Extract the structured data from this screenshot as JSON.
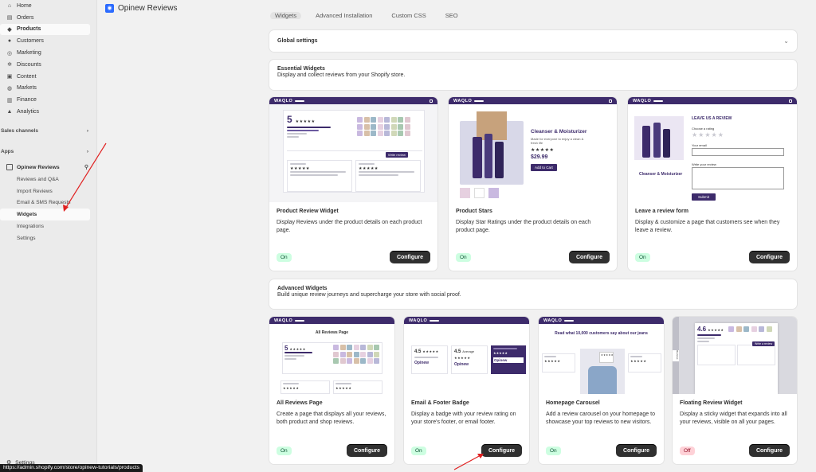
{
  "sidebar": {
    "nav": [
      {
        "label": "Home",
        "icon": "home-icon",
        "glyph": "⌂"
      },
      {
        "label": "Orders",
        "icon": "orders-icon",
        "glyph": "▤"
      },
      {
        "label": "Products",
        "icon": "products-icon",
        "glyph": "◆"
      },
      {
        "label": "Customers",
        "icon": "customers-icon",
        "glyph": "●"
      },
      {
        "label": "Marketing",
        "icon": "marketing-icon",
        "glyph": "◎"
      },
      {
        "label": "Discounts",
        "icon": "discounts-icon",
        "glyph": "✲"
      },
      {
        "label": "Content",
        "icon": "content-icon",
        "glyph": "▣"
      },
      {
        "label": "Markets",
        "icon": "markets-icon",
        "glyph": "◍"
      },
      {
        "label": "Finance",
        "icon": "finance-icon",
        "glyph": "▥"
      },
      {
        "label": "Analytics",
        "icon": "analytics-icon",
        "glyph": "▲"
      }
    ],
    "sales_channels": "Sales channels",
    "apps": "Apps",
    "app_name": "Opinew Reviews",
    "app_sub": [
      "Reviews and Q&A",
      "Import Reviews",
      "Email & SMS Requests",
      "Widgets",
      "Integrations",
      "Settings"
    ],
    "settings": "Settings",
    "status_url": "https://admin.shopify.com/store/opinew-tutorials/products"
  },
  "header": {
    "title": "Opinew Reviews"
  },
  "tabs": [
    "Widgets",
    "Advanced Installation",
    "Custom CSS",
    "SEO"
  ],
  "global": {
    "title": "Global settings"
  },
  "essential": {
    "title": "Essential Widgets",
    "desc": "Display and collect reviews from your Shopify store."
  },
  "advanced": {
    "title": "Advanced Widgets",
    "desc": "Build unique review journeys and supercharge your store with social proof."
  },
  "configure_label": "Configure",
  "widgets_essential": [
    {
      "title": "Product Review Widget",
      "desc": "Display Reviews under the product details on each product page.",
      "status": "On"
    },
    {
      "title": "Product Stars",
      "desc": "Display Star Ratings under the product details on each product page.",
      "status": "On"
    },
    {
      "title": "Leave a review form",
      "desc": "Display & customize a page that customers see when they leave a review.",
      "status": "On"
    }
  ],
  "widgets_advanced": [
    {
      "title": "All Reviews Page",
      "desc": "Create a page that displays all your reviews, both product and shop reviews.",
      "status": "On"
    },
    {
      "title": "Email & Footer Badge",
      "desc": "Display a badge with your review rating on your store's footer, or email footer.",
      "status": "On"
    },
    {
      "title": "Homepage Carousel",
      "desc": "Add a review carousel on your homepage to showcase your top reviews to new visitors.",
      "status": "On"
    },
    {
      "title": "Floating Review Widget",
      "desc": "Display a sticky widget that expands into all your reviews, visible on all your pages.",
      "status": "Off"
    }
  ],
  "previews": {
    "brand": "WAQLO",
    "big_rating": "5",
    "stars": "★★★★★",
    "cleanser_title": "Cleanser & Moisturizer",
    "cleanser_sub": "Made for everyone to enjoy a clean & fresh life",
    "price": "$29.99",
    "add_to_cart": "Add to Cart",
    "leave_review": "LEAVE US A REVIEW",
    "choose_rating": "Choose a rating",
    "your_email": "Your email",
    "write_review": "Write your review",
    "submit": "Submit",
    "cleanser_small": "Cleanser & Moisturizer",
    "all_reviews_page": "All Reviews Page",
    "badge_rating_1": "4.5",
    "badge_rating_2": "4.5",
    "badge_average": "Average",
    "badge_brand": "Opinew",
    "carousel_heading": "Read what 10,000 customers say about our jeans",
    "floating_rating": "4.6",
    "write_a_review": "Write a review",
    "write_review_btn": "Write review",
    "floating_tab": "Reviews"
  },
  "colors": {
    "brand_purple": "#3d2b6b",
    "on_badge": "#cdfee1",
    "off_badge": "#fed1d7",
    "arrow": "#e02020"
  }
}
